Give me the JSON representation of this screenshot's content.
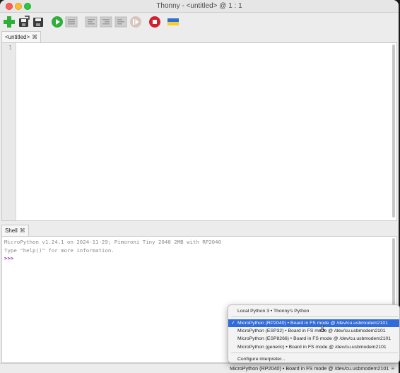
{
  "window": {
    "title": "Thonny - <untitled> @ 1 : 1"
  },
  "toolbar": {
    "buttons": [
      {
        "name": "new-file",
        "icon": "plus-icon"
      },
      {
        "name": "open-file",
        "icon": "open-icon"
      },
      {
        "name": "save-file",
        "icon": "save-icon"
      },
      {
        "name": "run",
        "icon": "run-icon"
      },
      {
        "name": "debug",
        "icon": "debug-icon"
      },
      {
        "name": "step-over",
        "icon": "step-over-icon"
      },
      {
        "name": "step-into",
        "icon": "step-into-icon"
      },
      {
        "name": "step-out",
        "icon": "step-out-icon"
      },
      {
        "name": "resume",
        "icon": "resume-icon"
      },
      {
        "name": "stop",
        "icon": "stop-icon"
      },
      {
        "name": "support-ukraine",
        "icon": "ukraine-flag-icon"
      }
    ],
    "colors": {
      "run": "#2fae3a",
      "stop": "#d4202c",
      "new": "#2fae3a"
    }
  },
  "editor": {
    "tab_label": "<untitled>",
    "tab_close": "⌘",
    "line_number": "1"
  },
  "shell": {
    "tab_label": "Shell",
    "tab_close": "⌘",
    "banner": "MicroPython v1.24.1 on 2024-11-29; Pimoroni Tiny 2040 2MB with RP2040",
    "help_line": "Type \"help()\" for more information.",
    "prompt": ">>>"
  },
  "interpreter_menu": {
    "items": [
      {
        "label": "Local Python 3  •  Thonny's Python",
        "selected": false
      },
      {
        "label": "MicroPython (RP2040)  •  Board in FS mode @ /dev/cu.usbmodem2101",
        "selected": true,
        "check": "✓"
      },
      {
        "label": "MicroPython (ESP32)  •  Board in FS mode @ /dev/cu.usbmodem2101",
        "selected": false
      },
      {
        "label": "MicroPython (ESP8266)  •  Board in FS mode @ /dev/cu.usbmodem2101",
        "selected": false
      },
      {
        "label": "MicroPython (generic)  •  Board in FS mode @ /dev/cu.usbmodem2101",
        "selected": false
      },
      {
        "label": "Configure interpreter...",
        "selected": false
      }
    ],
    "selected_color": "#2f6bd9"
  },
  "statusbar": {
    "interpreter": "MicroPython (RP2040)  •  Board in FS mode @ /dev/cu.usbmodem2101",
    "menu_glyph": "≡"
  }
}
